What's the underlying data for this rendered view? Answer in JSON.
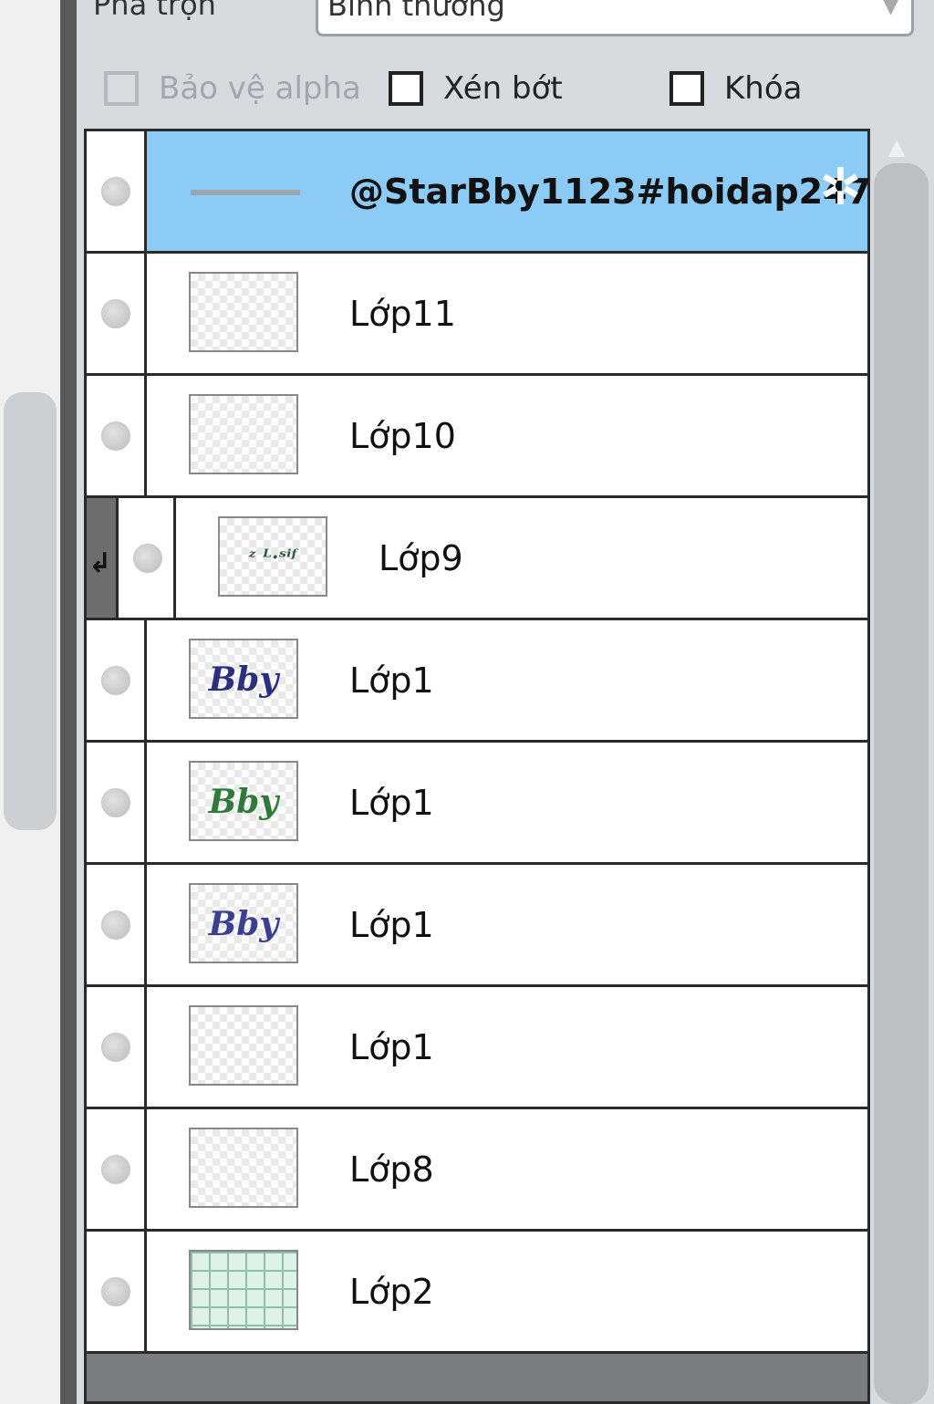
{
  "blend": {
    "label": "Pha trộn",
    "value": "Bình thường"
  },
  "options": {
    "protect_alpha": {
      "label": "Bảo vệ alpha",
      "enabled": false,
      "checked": false
    },
    "clip": {
      "label": "Xén bớt",
      "checked": false
    },
    "lock": {
      "label": "Khóa",
      "checked": false
    }
  },
  "layers": [
    {
      "name": "@StarBby1123#hoidap247",
      "selected": true,
      "thumb": "line-icon",
      "has_settings_icon": true
    },
    {
      "name": "Lớp11",
      "thumb": "transparent"
    },
    {
      "name": "Lớp10",
      "thumb": "transparent"
    },
    {
      "name": "Lớp9",
      "thumb": "sketch",
      "thumb_text": "ᶻ ᴸ·ˢⁱᶠ",
      "clipped": true
    },
    {
      "name": "Lớp1",
      "thumb": "lettering",
      "thumb_text": "Bby",
      "thumb_color": "#2c2f7a"
    },
    {
      "name": "Lớp1",
      "thumb": "lettering",
      "thumb_text": "Bby",
      "thumb_color": "#2f7a3a"
    },
    {
      "name": "Lớp1",
      "thumb": "lettering",
      "thumb_text": "Bby",
      "thumb_color": "#3a3f8f"
    },
    {
      "name": "Lớp1",
      "thumb": "transparent"
    },
    {
      "name": "Lớp8",
      "thumb": "transparent"
    },
    {
      "name": "Lớp2",
      "thumb": "grid"
    }
  ],
  "colors": {
    "selected_row": "#8ccbf5",
    "panel_bg": "#d7dbde",
    "list_border": "#2a2a2a"
  }
}
